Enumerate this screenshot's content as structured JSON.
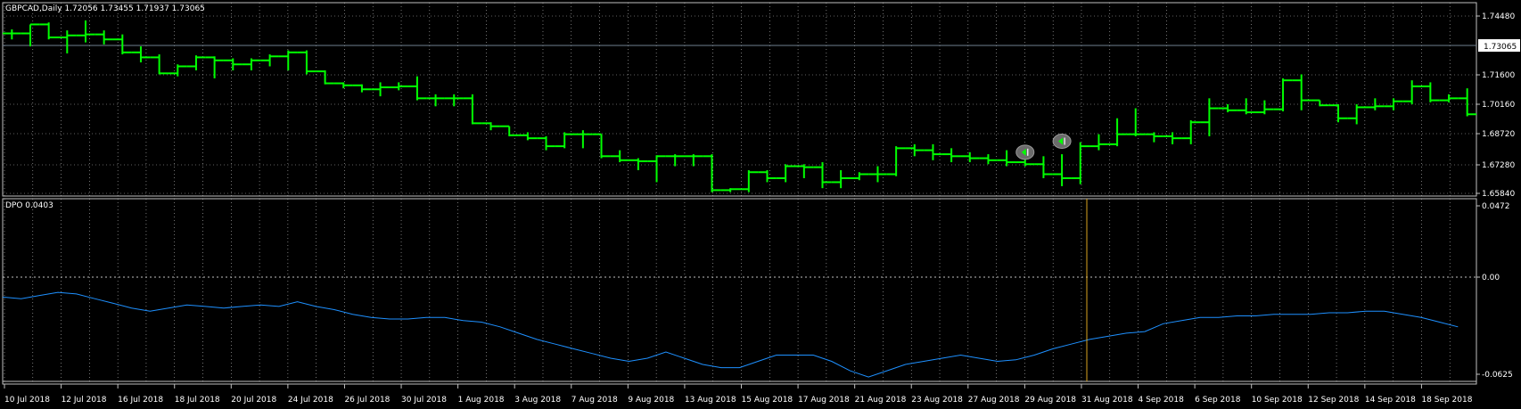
{
  "window": {
    "main_title": "GBPCAD,Daily  1.72056 1.73455 1.71937 1.73065",
    "indicator_title": "DPO 0.0403"
  },
  "colors": {
    "background": "#000000",
    "grid": "#c0c0c0",
    "bar": "#00ff00",
    "dpo_line": "#1e90ff",
    "current_price_line": "#708090",
    "vline": "#daa520",
    "label_box_bg": "#ffffff",
    "label_box_text": "#000000"
  },
  "price_axis": {
    "labels": [
      "1.74480",
      "1.71600",
      "1.70160",
      "1.68720",
      "1.67280",
      "1.65840"
    ],
    "current_price": "1.73065"
  },
  "indicator_axis": {
    "labels": [
      "0.0472",
      "0.00",
      "-0.0625"
    ]
  },
  "date_axis": {
    "labels": [
      "10 Jul 2018",
      "12 Jul 2018",
      "16 Jul 2018",
      "18 Jul 2018",
      "20 Jul 2018",
      "24 Jul 2018",
      "26 Jul 2018",
      "30 Jul 2018",
      "1 Aug 2018",
      "3 Aug 2018",
      "7 Aug 2018",
      "9 Aug 2018",
      "13 Aug 2018",
      "15 Aug 2018",
      "17 Aug 2018",
      "21 Aug 2018",
      "23 Aug 2018",
      "27 Aug 2018",
      "29 Aug 2018",
      "31 Aug 2018",
      "4 Sep 2018",
      "6 Sep 2018",
      "10 Sep 2018",
      "12 Sep 2018",
      "14 Sep 2018",
      "18 Sep 2018"
    ]
  },
  "chart_data": [
    {
      "type": "ohlc",
      "symbol": "GBPCAD",
      "timeframe": "Daily",
      "ylim": [
        1.6584,
        1.7472
      ],
      "bars": [
        {
          "o": 1.7385,
          "h": 1.7405,
          "l": 1.7355,
          "c": 1.7385
        },
        {
          "o": 1.7385,
          "h": 1.743,
          "l": 1.732,
          "c": 1.743
        },
        {
          "o": 1.743,
          "h": 1.744,
          "l": 1.7355,
          "c": 1.7365
        },
        {
          "o": 1.7365,
          "h": 1.74,
          "l": 1.7285,
          "c": 1.7375
        },
        {
          "o": 1.7375,
          "h": 1.745,
          "l": 1.734,
          "c": 1.738
        },
        {
          "o": 1.738,
          "h": 1.74,
          "l": 1.733,
          "c": 1.7355
        },
        {
          "o": 1.7355,
          "h": 1.738,
          "l": 1.728,
          "c": 1.729
        },
        {
          "o": 1.729,
          "h": 1.732,
          "l": 1.724,
          "c": 1.7265
        },
        {
          "o": 1.7265,
          "h": 1.728,
          "l": 1.718,
          "c": 1.7185
        },
        {
          "o": 1.7185,
          "h": 1.723,
          "l": 1.717,
          "c": 1.722
        },
        {
          "o": 1.722,
          "h": 1.7275,
          "l": 1.72,
          "c": 1.7265
        },
        {
          "o": 1.7265,
          "h": 1.727,
          "l": 1.716,
          "c": 1.725
        },
        {
          "o": 1.725,
          "h": 1.726,
          "l": 1.72,
          "c": 1.723
        },
        {
          "o": 1.723,
          "h": 1.726,
          "l": 1.72,
          "c": 1.725
        },
        {
          "o": 1.725,
          "h": 1.728,
          "l": 1.722,
          "c": 1.727
        },
        {
          "o": 1.727,
          "h": 1.73,
          "l": 1.72,
          "c": 1.729
        },
        {
          "o": 1.729,
          "h": 1.73,
          "l": 1.718,
          "c": 1.7195
        },
        {
          "o": 1.7195,
          "h": 1.72,
          "l": 1.713,
          "c": 1.7135
        },
        {
          "o": 1.7135,
          "h": 1.714,
          "l": 1.711,
          "c": 1.7125
        },
        {
          "o": 1.7125,
          "h": 1.713,
          "l": 1.709,
          "c": 1.7105
        },
        {
          "o": 1.7105,
          "h": 1.714,
          "l": 1.707,
          "c": 1.7115
        },
        {
          "o": 1.7115,
          "h": 1.714,
          "l": 1.71,
          "c": 1.712
        },
        {
          "o": 1.712,
          "h": 1.717,
          "l": 1.705,
          "c": 1.706
        },
        {
          "o": 1.706,
          "h": 1.708,
          "l": 1.702,
          "c": 1.706
        },
        {
          "o": 1.706,
          "h": 1.708,
          "l": 1.702,
          "c": 1.706
        },
        {
          "o": 1.706,
          "h": 1.708,
          "l": 1.693,
          "c": 1.6935
        },
        {
          "o": 1.6935,
          "h": 1.694,
          "l": 1.69,
          "c": 1.692
        },
        {
          "o": 1.692,
          "h": 1.692,
          "l": 1.687,
          "c": 1.6875
        },
        {
          "o": 1.6875,
          "h": 1.689,
          "l": 1.685,
          "c": 1.686
        },
        {
          "o": 1.686,
          "h": 1.687,
          "l": 1.68,
          "c": 1.682
        },
        {
          "o": 1.682,
          "h": 1.689,
          "l": 1.681,
          "c": 1.688
        },
        {
          "o": 1.688,
          "h": 1.69,
          "l": 1.681,
          "c": 1.688
        },
        {
          "o": 1.688,
          "h": 1.688,
          "l": 1.676,
          "c": 1.677
        },
        {
          "o": 1.677,
          "h": 1.68,
          "l": 1.674,
          "c": 1.675
        },
        {
          "o": 1.675,
          "h": 1.676,
          "l": 1.67,
          "c": 1.6745
        },
        {
          "o": 1.6745,
          "h": 1.6775,
          "l": 1.664,
          "c": 1.677
        },
        {
          "o": 1.677,
          "h": 1.678,
          "l": 1.672,
          "c": 1.677
        },
        {
          "o": 1.677,
          "h": 1.678,
          "l": 1.672,
          "c": 1.677
        },
        {
          "o": 1.677,
          "h": 1.678,
          "l": 1.659,
          "c": 1.66
        },
        {
          "o": 1.66,
          "h": 1.661,
          "l": 1.659,
          "c": 1.6605
        },
        {
          "o": 1.6605,
          "h": 1.67,
          "l": 1.659,
          "c": 1.669
        },
        {
          "o": 1.669,
          "h": 1.67,
          "l": 1.664,
          "c": 1.666
        },
        {
          "o": 1.666,
          "h": 1.673,
          "l": 1.664,
          "c": 1.672
        },
        {
          "o": 1.672,
          "h": 1.673,
          "l": 1.666,
          "c": 1.6715
        },
        {
          "o": 1.6715,
          "h": 1.674,
          "l": 1.661,
          "c": 1.664
        },
        {
          "o": 1.664,
          "h": 1.67,
          "l": 1.661,
          "c": 1.666
        },
        {
          "o": 1.666,
          "h": 1.669,
          "l": 1.665,
          "c": 1.668
        },
        {
          "o": 1.668,
          "h": 1.672,
          "l": 1.664,
          "c": 1.668
        },
        {
          "o": 1.668,
          "h": 1.682,
          "l": 1.667,
          "c": 1.681
        },
        {
          "o": 1.681,
          "h": 1.683,
          "l": 1.677,
          "c": 1.68
        },
        {
          "o": 1.68,
          "h": 1.683,
          "l": 1.675,
          "c": 1.678
        },
        {
          "o": 1.678,
          "h": 1.681,
          "l": 1.674,
          "c": 1.677
        },
        {
          "o": 1.677,
          "h": 1.679,
          "l": 1.674,
          "c": 1.676
        },
        {
          "o": 1.676,
          "h": 1.678,
          "l": 1.673,
          "c": 1.675
        },
        {
          "o": 1.675,
          "h": 1.68,
          "l": 1.672,
          "c": 1.674
        },
        {
          "o": 1.674,
          "h": 1.676,
          "l": 1.672,
          "c": 1.673
        },
        {
          "o": 1.673,
          "h": 1.677,
          "l": 1.666,
          "c": 1.668
        },
        {
          "o": 1.668,
          "h": 1.678,
          "l": 1.662,
          "c": 1.666
        },
        {
          "o": 1.666,
          "h": 1.684,
          "l": 1.663,
          "c": 1.682
        },
        {
          "o": 1.682,
          "h": 1.688,
          "l": 1.68,
          "c": 1.683
        },
        {
          "o": 1.683,
          "h": 1.696,
          "l": 1.682,
          "c": 1.688
        },
        {
          "o": 1.688,
          "h": 1.701,
          "l": 1.687,
          "c": 1.688
        },
        {
          "o": 1.688,
          "h": 1.689,
          "l": 1.684,
          "c": 1.687
        },
        {
          "o": 1.687,
          "h": 1.689,
          "l": 1.683,
          "c": 1.686
        },
        {
          "o": 1.686,
          "h": 1.695,
          "l": 1.683,
          "c": 1.694
        },
        {
          "o": 1.694,
          "h": 1.706,
          "l": 1.687,
          "c": 1.701
        },
        {
          "o": 1.701,
          "h": 1.703,
          "l": 1.699,
          "c": 1.7
        },
        {
          "o": 1.7,
          "h": 1.706,
          "l": 1.698,
          "c": 1.699
        },
        {
          "o": 1.699,
          "h": 1.705,
          "l": 1.698,
          "c": 1.7005
        },
        {
          "o": 1.7005,
          "h": 1.716,
          "l": 1.6995,
          "c": 1.715
        },
        {
          "o": 1.715,
          "h": 1.718,
          "l": 1.7,
          "c": 1.705
        },
        {
          "o": 1.705,
          "h": 1.705,
          "l": 1.702,
          "c": 1.7025
        },
        {
          "o": 1.7025,
          "h": 1.703,
          "l": 1.694,
          "c": 1.696
        },
        {
          "o": 1.696,
          "h": 1.703,
          "l": 1.693,
          "c": 1.7015
        },
        {
          "o": 1.7015,
          "h": 1.706,
          "l": 1.7,
          "c": 1.702
        },
        {
          "o": 1.702,
          "h": 1.706,
          "l": 1.7,
          "c": 1.7045
        },
        {
          "o": 1.7045,
          "h": 1.715,
          "l": 1.703,
          "c": 1.712
        },
        {
          "o": 1.712,
          "h": 1.714,
          "l": 1.704,
          "c": 1.705
        },
        {
          "o": 1.705,
          "h": 1.708,
          "l": 1.704,
          "c": 1.706
        },
        {
          "o": 1.706,
          "h": 1.711,
          "l": 1.697,
          "c": 1.698
        }
      ],
      "markers": [
        {
          "bar": 55,
          "price": 1.679
        },
        {
          "bar": 57,
          "price": 1.6845
        }
      ]
    },
    {
      "type": "line",
      "title": "DPO 0.0403",
      "ylim": [
        -0.0625,
        0.0472
      ],
      "series": [
        {
          "values": [
            -0.011,
            -0.012,
            -0.01,
            -0.008,
            -0.009,
            -0.012,
            -0.015,
            -0.018,
            -0.02,
            -0.018,
            -0.016,
            -0.017,
            -0.018,
            -0.017,
            -0.016,
            -0.017,
            -0.014,
            -0.017,
            -0.019,
            -0.022,
            -0.024,
            -0.025,
            -0.025,
            -0.024,
            -0.024,
            -0.026,
            -0.027,
            -0.03,
            -0.034,
            -0.038,
            -0.041,
            -0.044,
            -0.047,
            -0.05,
            -0.052,
            -0.05,
            -0.046,
            -0.05,
            -0.054,
            -0.056,
            -0.056,
            -0.052,
            -0.048,
            -0.048,
            -0.048,
            -0.052,
            -0.058,
            -0.062,
            -0.058,
            -0.054,
            -0.052,
            -0.05,
            -0.048,
            -0.05,
            -0.052,
            -0.051,
            -0.048,
            -0.044,
            -0.041,
            -0.038,
            -0.036,
            -0.034,
            -0.033,
            -0.028,
            -0.026,
            -0.024,
            -0.024,
            -0.023,
            -0.023,
            -0.022,
            -0.022,
            -0.022,
            -0.021,
            -0.021,
            -0.02,
            -0.02,
            -0.022,
            -0.024,
            -0.027,
            -0.03
          ]
        }
      ]
    }
  ]
}
